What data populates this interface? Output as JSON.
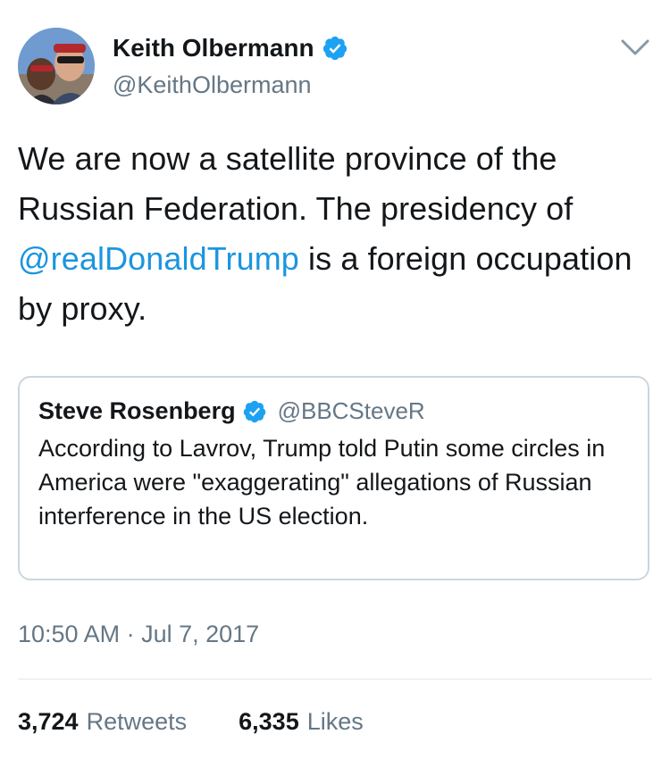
{
  "author": {
    "name": "Keith Olbermann",
    "handle": "@KeithOlbermann",
    "verified": true,
    "avatar_icon": "profile-photo"
  },
  "tweet": {
    "text_before_mention": "We are now a satellite province of the Russian Federation. The presidency of ",
    "mention": "@realDonaldTrump",
    "text_after_mention": " is a foreign occupation by proxy.",
    "timestamp": "10:50 AM · Jul 7, 2017"
  },
  "quoted_tweet": {
    "name": "Steve Rosenberg",
    "handle": "@BBCSteveR",
    "verified": true,
    "text": "According to Lavrov, Trump told Putin some circles in America were \"exaggerating\" allegations of Russian interference in the US election."
  },
  "stats": {
    "retweets_count": "3,724",
    "retweets_label": "Retweets",
    "likes_count": "6,335",
    "likes_label": "Likes"
  },
  "colors": {
    "link": "#1b95e0",
    "verified_badge": "#1da1f2",
    "secondary_text": "#657786",
    "border": "#ccd6dd"
  },
  "icons": {
    "verified": "verified-badge-icon",
    "menu": "chevron-down-icon"
  }
}
